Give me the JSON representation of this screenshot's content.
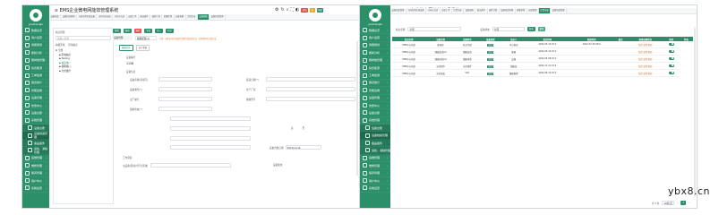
{
  "app_title": "EMS企业微电网能效管理系统",
  "user": "yuezhiangtu",
  "watermark": "ybx8.cn",
  "menu_left": [
    {
      "label": "数据总览",
      "has_sub": true
    },
    {
      "label": "用户运营",
      "has_sub": true
    },
    {
      "label": "用能规划",
      "has_sub": true
    },
    {
      "label": "能耗分析",
      "has_sub": true
    },
    {
      "label": "碳排放管理",
      "has_sub": true
    },
    {
      "label": "综合能源",
      "has_sub": true
    },
    {
      "label": "工单监测",
      "has_sub": true
    },
    {
      "label": "报表统计",
      "has_sub": true
    },
    {
      "label": "智能运维",
      "has_sub": true
    },
    {
      "label": "设备管理",
      "has_sub": true
    },
    {
      "label": "告警中心",
      "has_sub": true
    },
    {
      "label": "设备台账",
      "has_sub": true
    },
    {
      "label": "系统管理",
      "has_sub": true
    }
  ],
  "submenu_left": [
    {
      "label": "设备台账",
      "active": false
    },
    {
      "label": "设备档案管理",
      "active": true
    },
    {
      "label": "备品备件",
      "active": false
    },
    {
      "label": "巡检、消缺管理",
      "active": false
    }
  ],
  "menu_left_after": [
    {
      "label": "运维管理"
    },
    {
      "label": "维修管理"
    },
    {
      "label": "保养管理"
    },
    {
      "label": "用户中心"
    },
    {
      "label": "系统设置"
    }
  ],
  "tabs_left": [
    "设备档案",
    "设备档案管理",
    "当前位置区域设备",
    "光伏电站运维",
    "分布式光伏",
    "运维工单",
    "备品备件",
    "巡检计划",
    "质量检测",
    "运维管理",
    "告警记录",
    "设备故障",
    "设备档案管理"
  ],
  "tabs_right": [
    "设备档案管理",
    "当前位置区域设备",
    "分布式光伏",
    "运维工单",
    "告警记录",
    "设备故障",
    "备品备件",
    "巡检计划",
    "设备档案管理",
    "质量检测",
    "运维管理",
    "告警记录",
    "设备档案管理"
  ],
  "badges": [
    {
      "label": "消息",
      "color": "#e84c4c"
    },
    {
      "label": "新",
      "color": "#f0a030"
    },
    {
      "label": "帮助",
      "color": "#2b8f69"
    }
  ],
  "tree": {
    "search_label": "站点管理",
    "search_placeholder": "请输入名称",
    "company_tab": "两级区域",
    "site_tab": "区域站点",
    "nodes": [
      "全部",
      "配电站房",
      "Testing",
      "输变电()",
      "储能箱(-)",
      "光伏组件"
    ]
  },
  "form": {
    "toolbar_buttons": [
      "新增",
      "编辑",
      "删除",
      "导出",
      "导入",
      "打印"
    ],
    "breadcrumb": "设备管理",
    "search_value": "储能配置(1)",
    "notice": "注意：基本信息中请填写完整且真实的信息，否则将影响计划生成",
    "subtabs": [
      "基础信息",
      "运行参数"
    ],
    "section_title": "设备信息",
    "section_code": "设备编号",
    "section_code_value": "1158",
    "fields": [
      {
        "label": "设备信息",
        "value": ""
      },
      {
        "label": "设备名称(请填写)",
        "value": ""
      },
      {
        "label": "投运日期(*)",
        "value": "2021/11/14"
      },
      {
        "label": "设备类型(*)",
        "value": ""
      },
      {
        "label": "生产厂家",
        "value": ""
      },
      {
        "label": "出厂编号",
        "value": ""
      },
      {
        "label": "规格型号",
        "value": ""
      },
      {
        "label": "运维状态(*)",
        "value": ""
      },
      {
        "label": "是",
        "value": "否"
      }
    ],
    "date_label": "设备台账日期",
    "date_value": "2021/11/14",
    "footer_label": "工作流程",
    "footer_field1": "主设备(区域)/型号(区域)",
    "footer_field2": "设备使用"
  },
  "table": {
    "filter_label_1": "站点名称",
    "filter_value_1": "全部",
    "filter_label_2": "设备状态",
    "filter_value_2": "全部",
    "search_button": "查询",
    "reset_button": "重置",
    "columns": [
      "站点名称",
      "设备名称",
      "设备型号",
      "设备类型",
      "投运人",
      "投运时间",
      "检修时间",
      "备注",
      "报修设备情况",
      "操作",
      "状态"
    ],
    "rows": [
      [
        "EMS中心机房",
        "配电柜",
        "柜式空调",
        "运行",
        "中心机房",
        "2022-05-14 15:2",
        "2022-07-30 06:0",
        "",
        "查看 编辑 删除",
        "启用"
      ],
      [
        "EMS中心机房",
        "储能变流(2)",
        "储能变流",
        "运行",
        "储能",
        "2022-05-14 15:2",
        "",
        "",
        "查看 编辑 删除",
        "启用"
      ],
      [
        "EMS中心机房",
        "储能电池(4)",
        "储能电池",
        "运行",
        "设备",
        "2022-05-08 15:2",
        "",
        "",
        "查看 编辑 删除",
        "启用"
      ],
      [
        "EMS中心机房",
        "光伏组件",
        "光伏组件",
        "运行",
        "储能变",
        "2022-11-11 15:4",
        "",
        "",
        "查看 编辑 删除",
        "启用"
      ],
      [
        "EMS中心机房",
        "光伏逆变",
        "VAV",
        "运行",
        "储能配置",
        "2022-09-10 15:2",
        "",
        "",
        "查看 编辑 删除",
        "启用"
      ]
    ],
    "pagination": "共 5 条",
    "page_size": "10条/页",
    "page": "1"
  },
  "colors": {
    "primary": "#2b8f69",
    "sidebar": "#2b8f69"
  }
}
